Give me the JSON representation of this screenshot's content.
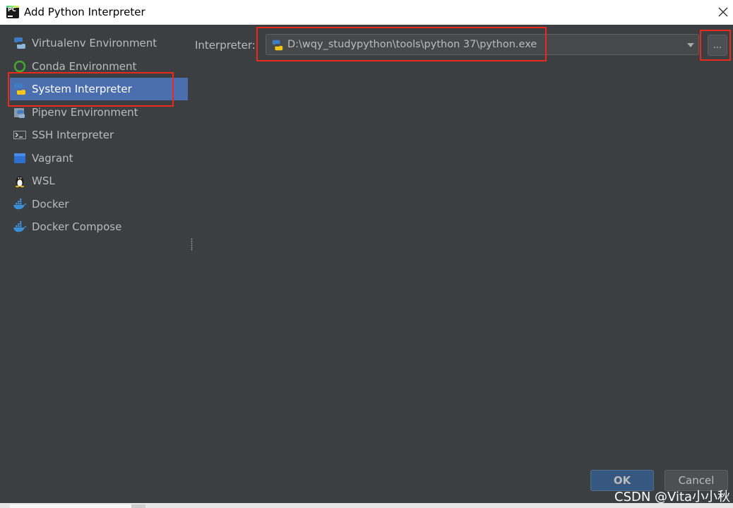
{
  "window": {
    "title": "Add Python Interpreter",
    "app_icon": "pycharm-icon",
    "app_icon_text": "PC",
    "close_icon": "close-icon"
  },
  "sidebar": {
    "items": [
      {
        "label": "Virtualenv Environment",
        "icon": "virtualenv-icon"
      },
      {
        "label": "Conda Environment",
        "icon": "conda-icon"
      },
      {
        "label": "System Interpreter",
        "icon": "python-icon",
        "selected": true
      },
      {
        "label": "Pipenv Environment",
        "icon": "pipenv-icon"
      },
      {
        "label": "SSH Interpreter",
        "icon": "terminal-icon"
      },
      {
        "label": "Vagrant",
        "icon": "vagrant-icon"
      },
      {
        "label": "WSL",
        "icon": "linux-penguin-icon"
      },
      {
        "label": "Docker",
        "icon": "docker-icon"
      },
      {
        "label": "Docker Compose",
        "icon": "docker-compose-icon"
      }
    ]
  },
  "main": {
    "interpreter_label": "Interpreter:",
    "interpreter_value": "D:\\wqy_studypython\\tools\\python 37\\python.exe",
    "browse_label": "..."
  },
  "footer": {
    "ok_label": "OK",
    "cancel_label": "Cancel"
  },
  "watermark": "CSDN @Vita小小秋",
  "colors": {
    "background": "#3c3f41",
    "selection": "#4b6eaf",
    "highlight": "#e8291c",
    "text": "#bbbbbb",
    "ok_button": "#365880"
  }
}
